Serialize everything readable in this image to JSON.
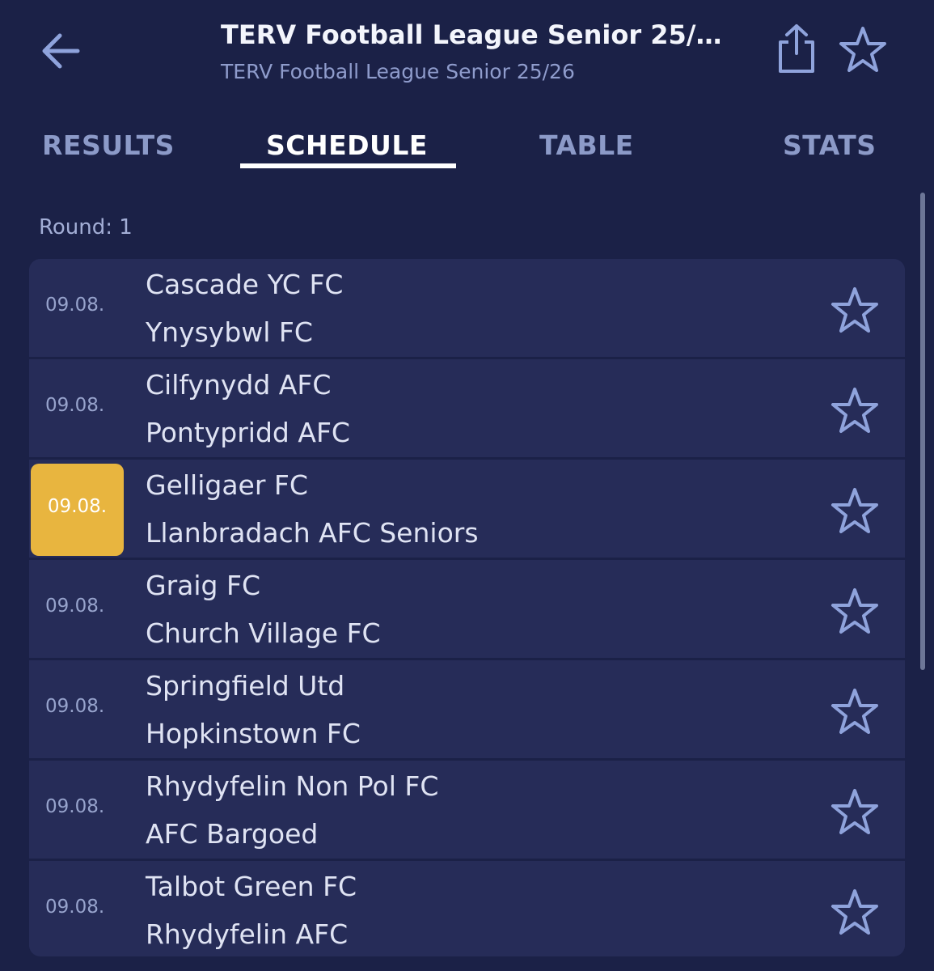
{
  "header": {
    "title": "TERV Football League Senior 25/…",
    "subtitle": "TERV Football League Senior 25/26",
    "back_icon": "arrow-left-icon",
    "share_icon": "share-icon",
    "favorite_icon": "star-outline-icon"
  },
  "tabs": [
    {
      "label": "RESULTS"
    },
    {
      "label": "SCHEDULE",
      "active": true
    },
    {
      "label": "TABLE"
    },
    {
      "label": "STATS"
    }
  ],
  "round_label": "Round: 1",
  "matches": [
    {
      "date": "09.08.",
      "home": "Cascade YC FC",
      "away": "Ynysybwl FC"
    },
    {
      "date": "09.08.",
      "home": "Cilfynydd AFC",
      "away": "Pontypridd AFC"
    },
    {
      "date": "09.08.",
      "home": "Gelligaer FC",
      "away": "Llanbradach AFC Seniors",
      "highlighted": true
    },
    {
      "date": "09.08.",
      "home": "Graig FC",
      "away": "Church Village FC"
    },
    {
      "date": "09.08.",
      "home": "Springfield Utd",
      "away": "Hopkinstown FC"
    },
    {
      "date": "09.08.",
      "home": "Rhydyfelin Non Pol FC",
      "away": "AFC Bargoed"
    },
    {
      "date": "09.08.",
      "home": "Talbot Green FC",
      "away": "Rhydyfelin AFC"
    }
  ],
  "colors": {
    "background": "#1b2147",
    "card": "#262c58",
    "highlight": "#e8b53f",
    "accent_icon": "#8fa3dc"
  }
}
